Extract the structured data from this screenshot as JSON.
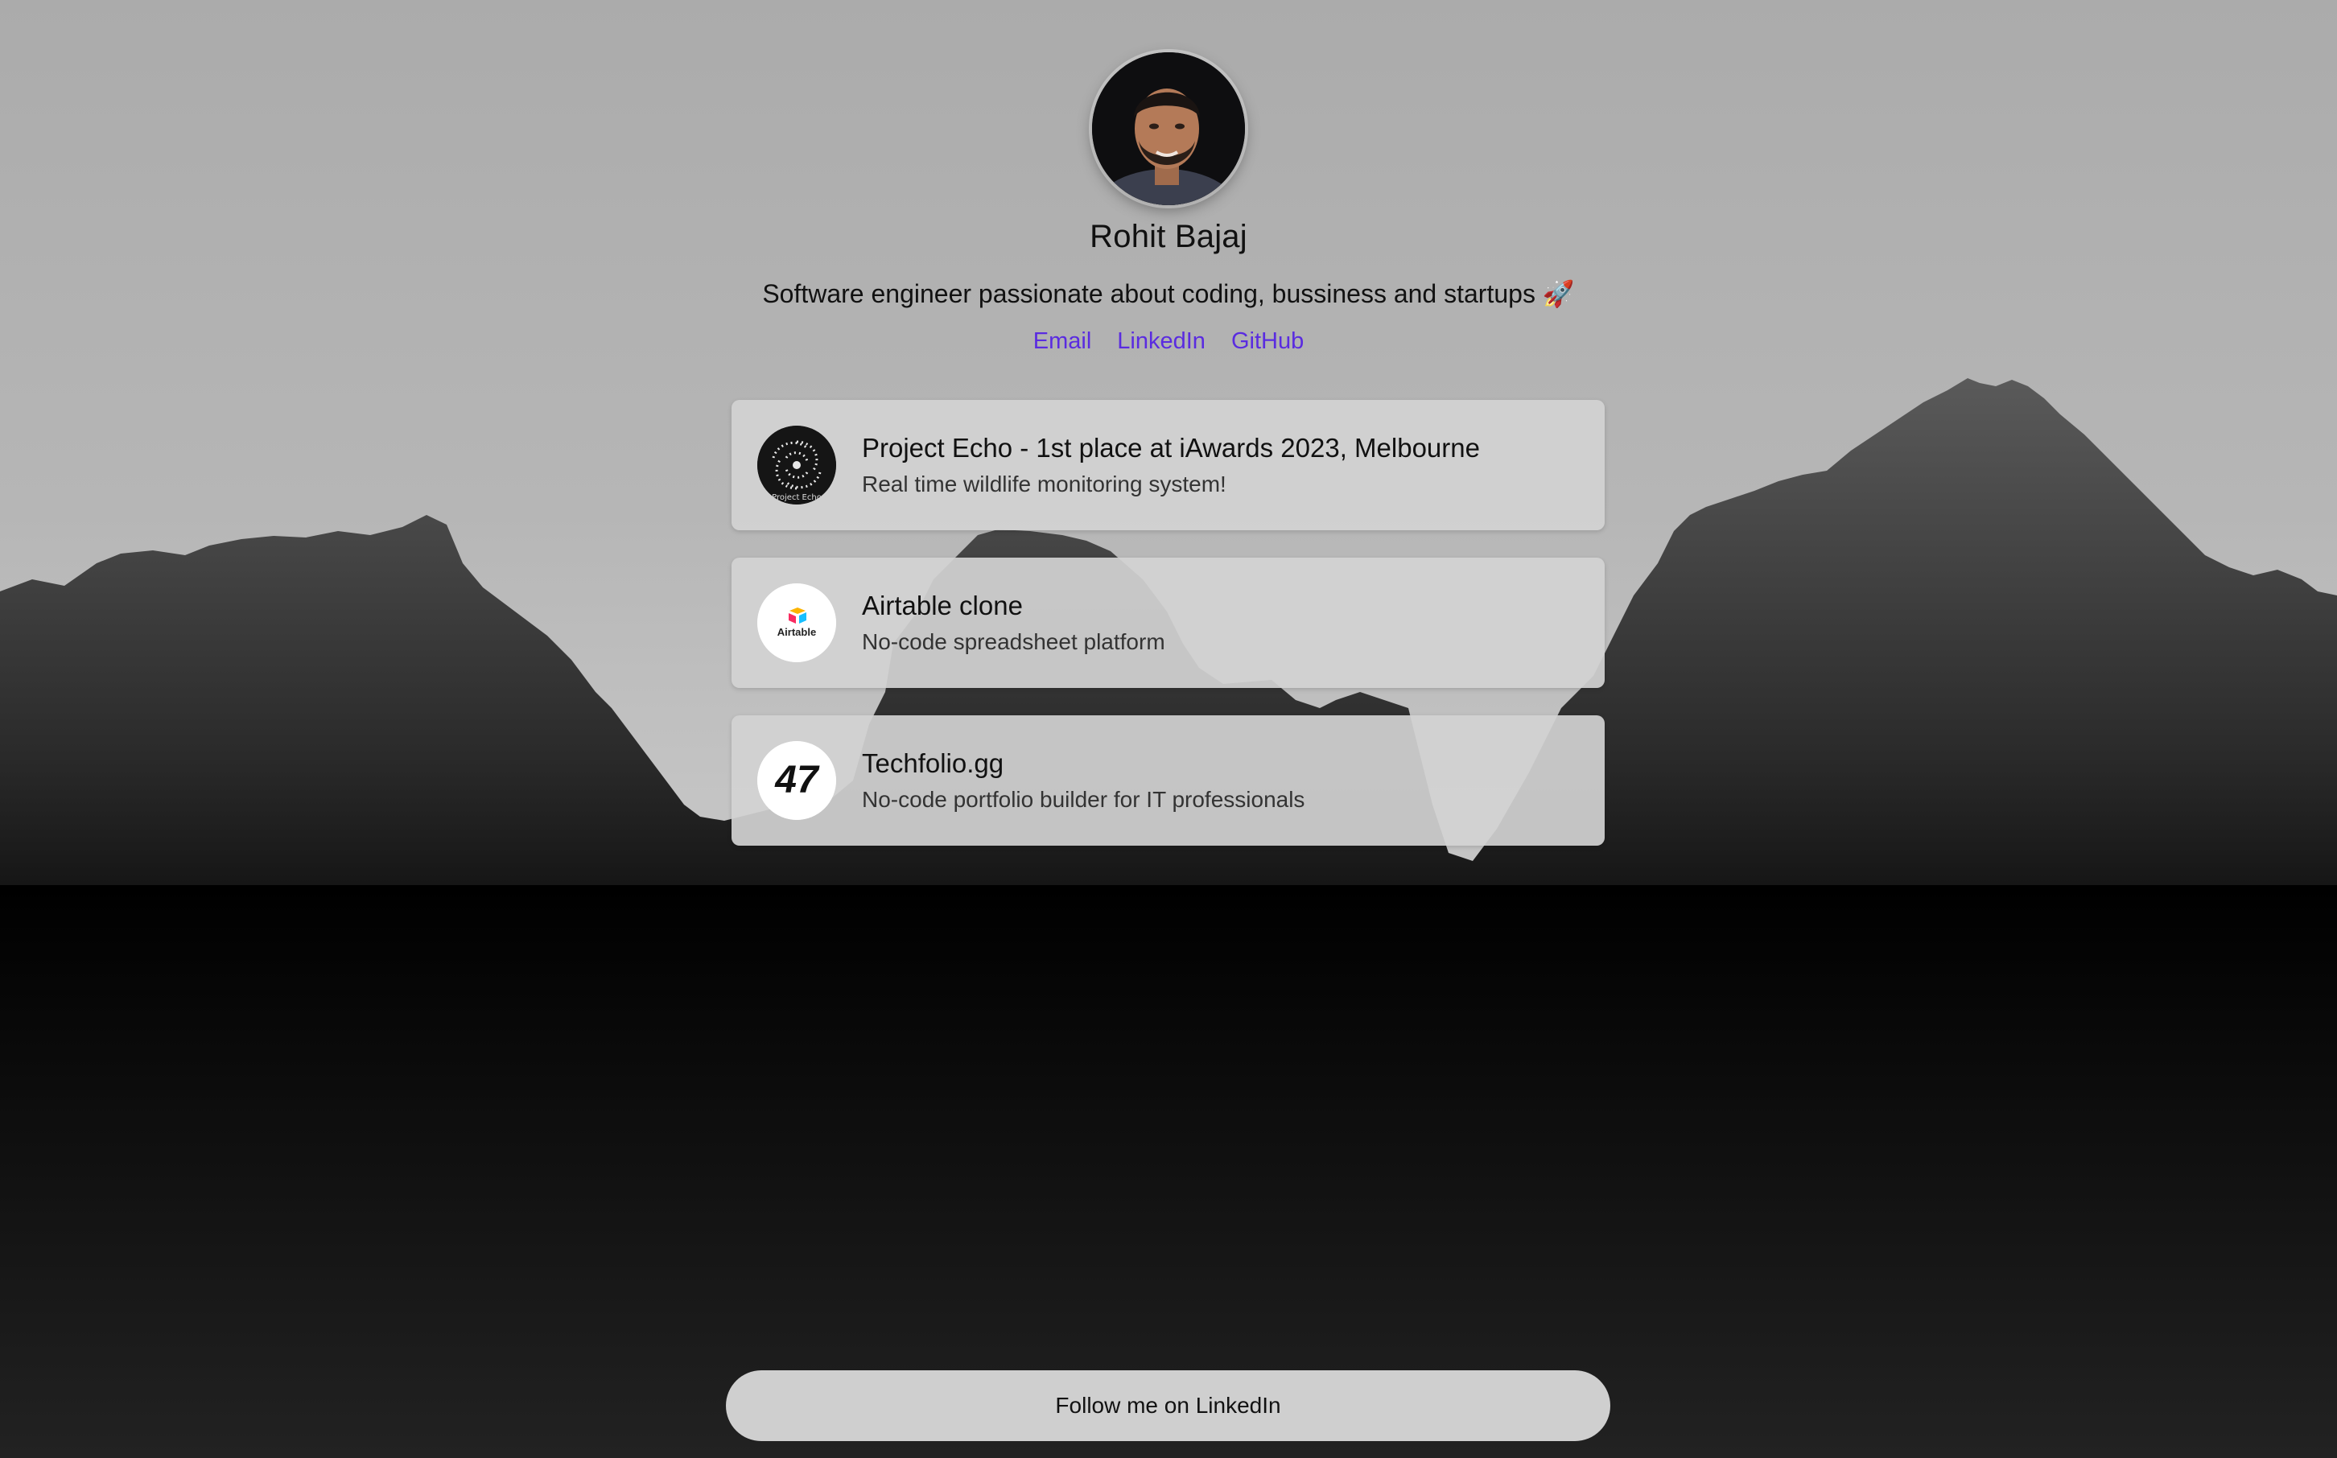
{
  "profile": {
    "name": "Rohit Bajaj",
    "bio": "Software engineer passionate about coding, bussiness and startups 🚀",
    "avatar_icon": "profile-photo"
  },
  "links": {
    "email": "Email",
    "linkedin": "LinkedIn",
    "github": "GitHub"
  },
  "projects": [
    {
      "title": "Project Echo - 1st place at iAwards 2023, Melbourne",
      "subtitle": "Real time wildlife monitoring system!",
      "icon": "project-echo-logo",
      "logo_text": "Project Echo"
    },
    {
      "title": "Airtable clone",
      "subtitle": "No-code spreadsheet platform",
      "icon": "airtable-logo",
      "logo_text": "Airtable"
    },
    {
      "title": "Techfolio.gg",
      "subtitle": "No-code portfolio builder for IT professionals",
      "icon": "techfolio-logo",
      "logo_text": "47"
    }
  ],
  "cta": {
    "label": "Follow me on LinkedIn"
  },
  "colors": {
    "link": "#5a2be0",
    "card_bg": "#d2d2d2",
    "button_bg": "#cfcfcf"
  }
}
